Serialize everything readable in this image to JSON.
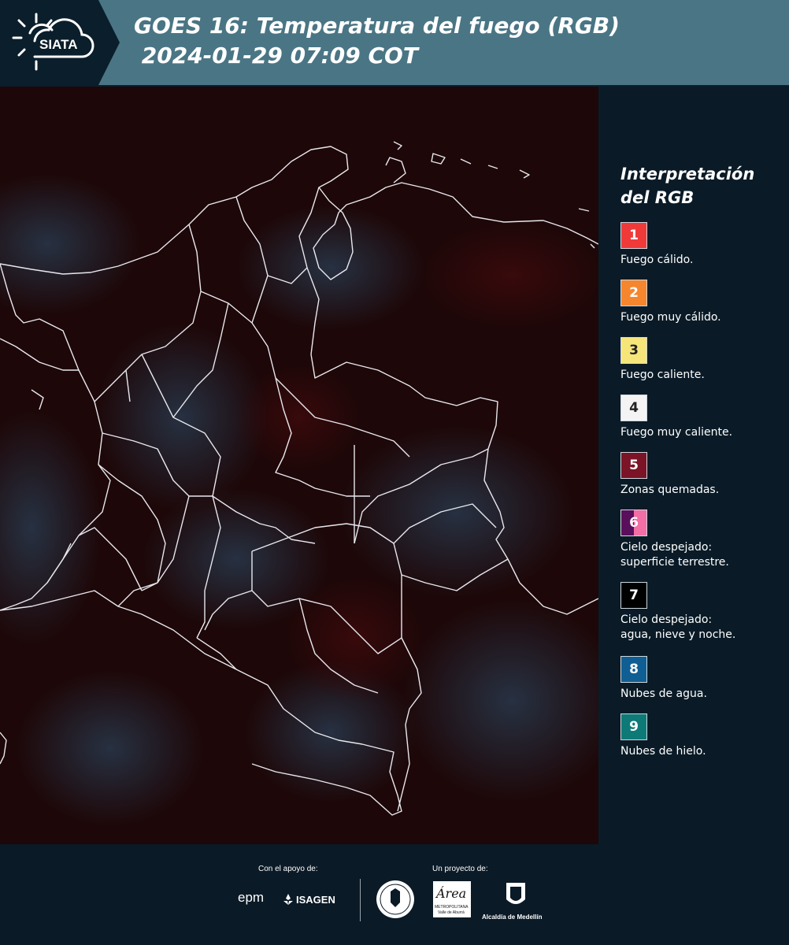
{
  "header": {
    "logo_text": "SIATA",
    "title_line1": "GOES 16: Temperatura del fuego (RGB)",
    "title_line2": " 2024-01-29 07:09 COT"
  },
  "legend": {
    "title": "Interpretación del RGB",
    "items": [
      {
        "number": "1",
        "label": "Fuego cálido.",
        "color": "#f03a3a"
      },
      {
        "number": "2",
        "label": "Fuego muy cálido.",
        "color": "#f5862e"
      },
      {
        "number": "3",
        "label": "Fuego caliente.",
        "color": "#f6e67a"
      },
      {
        "number": "4",
        "label": "Fuego muy caliente.",
        "color": "#f4f4f4"
      },
      {
        "number": "5",
        "label": "Zonas quemadas.",
        "color": "#7a1426"
      },
      {
        "number": "6",
        "label": "Cielo despejado:\nsuperficie terrestre.",
        "color": "#5a0f5c",
        "color2": "#f26ea4"
      },
      {
        "number": "7",
        "label": "Cielo despejado:\nagua, nieve y noche.",
        "color": "#000000"
      },
      {
        "number": "8",
        "label": "Nubes de agua.",
        "color": "#0f5f94"
      },
      {
        "number": "9",
        "label": "Nubes de hielo.",
        "color": "#0e7a78"
      }
    ]
  },
  "footer": {
    "support_label": "Con el apoyo de:",
    "project_label": "Un proyecto de:",
    "sponsor_epm": "epm",
    "sponsor_isagen": "ISAGEN",
    "area_caption": "METROPOLITANA",
    "area_sub": "Valle de Aburrá",
    "alcaldia": "Alcaldía de Medellín",
    "area_logo": "Área"
  }
}
